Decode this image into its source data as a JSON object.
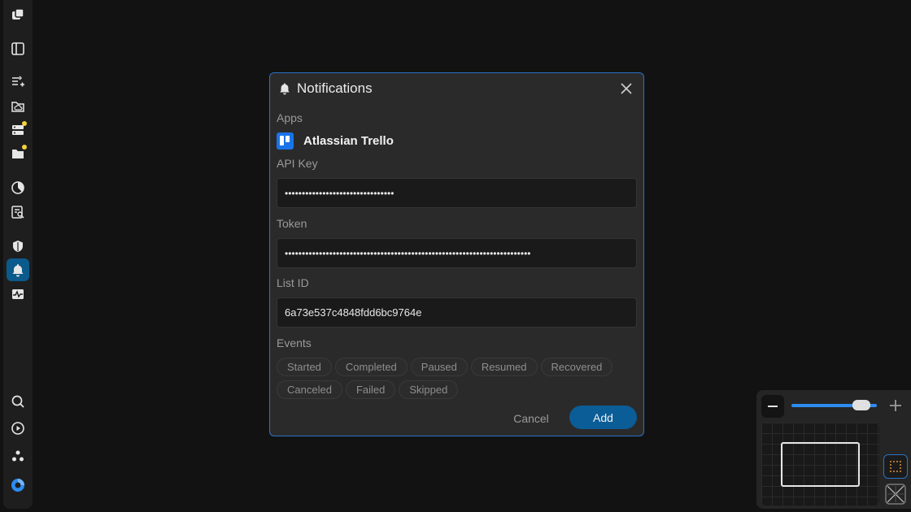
{
  "sidebar": {
    "items": [
      {
        "name": "logo-icon"
      },
      {
        "name": "sidebar-panel-icon"
      },
      {
        "name": "add-flow-icon"
      },
      {
        "name": "cloud-folder-icon"
      },
      {
        "name": "server-icon"
      },
      {
        "name": "folder-icon"
      },
      {
        "name": "pie-chart-icon"
      },
      {
        "name": "search-document-icon"
      },
      {
        "name": "shield-icon"
      },
      {
        "name": "bell-icon",
        "active": true
      },
      {
        "name": "activity-icon"
      },
      {
        "name": "search-icon"
      },
      {
        "name": "play-icon"
      },
      {
        "name": "nodes-icon"
      },
      {
        "name": "profile-icon"
      }
    ],
    "accent_color": "#0b5a8c",
    "badge_color": "#f3d23c"
  },
  "modal": {
    "title": "Notifications",
    "apps_label": "Apps",
    "app_name": "Atlassian Trello",
    "api_key_label": "API Key",
    "api_key_value": "••••••••••••••••••••••••••••••••",
    "token_label": "Token",
    "token_value": "••••••••••••••••••••••••••••••••••••••••••••••••••••••••••••••••••••••••",
    "list_id_label": "List ID",
    "list_id_value": "6a73e537c4848fdd6bc9764e",
    "events_label": "Events",
    "events": [
      "Started",
      "Completed",
      "Paused",
      "Resumed",
      "Recovered",
      "Canceled",
      "Failed",
      "Skipped"
    ],
    "cancel_label": "Cancel",
    "add_label": "Add",
    "border_color": "#2b72c4",
    "add_color": "#0a5d97"
  },
  "zoom": {
    "level_fraction": 0.9
  }
}
